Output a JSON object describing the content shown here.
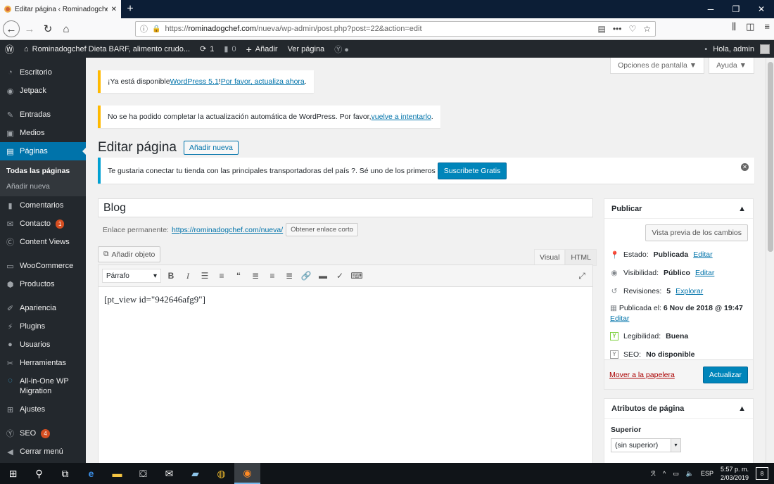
{
  "browser": {
    "tab_title": "Editar página ‹ Rominadogchef",
    "new_tab": "+",
    "url_prefix": "https://",
    "url_domain": "rominadogchef.com",
    "url_path": "/nueva/wp-admin/post.php?post=22&action=edit"
  },
  "adminbar": {
    "site": "Rominadogchef Dieta BARF, alimento crudo...",
    "updates": "1",
    "comments": "0",
    "new": "Añadir",
    "view": "Ver página",
    "howdy": "Hola, admin"
  },
  "sidebar": {
    "items": [
      {
        "label": "Escritorio",
        "icon": "dashboard-icon"
      },
      {
        "label": "Jetpack",
        "icon": "jetpack-icon"
      },
      {
        "label": "Entradas",
        "icon": "pin-icon"
      },
      {
        "label": "Medios",
        "icon": "media-icon"
      },
      {
        "label": "Páginas",
        "icon": "pages-icon"
      },
      {
        "label": "Comentarios",
        "icon": "comments-icon"
      },
      {
        "label": "Contacto",
        "icon": "mail-icon",
        "badge": "1"
      },
      {
        "label": "Content Views",
        "icon": "cv-icon"
      },
      {
        "label": "WooCommerce",
        "icon": "woo-icon"
      },
      {
        "label": "Productos",
        "icon": "box-icon"
      },
      {
        "label": "Apariencia",
        "icon": "brush-icon"
      },
      {
        "label": "Plugins",
        "icon": "plug-icon"
      },
      {
        "label": "Usuarios",
        "icon": "users-icon"
      },
      {
        "label": "Herramientas",
        "icon": "wrench-icon"
      },
      {
        "label": "All-in-One WP Migration",
        "icon": "migration-icon"
      },
      {
        "label": "Ajustes",
        "icon": "settings-icon"
      },
      {
        "label": "SEO",
        "icon": "yoast-icon",
        "badge": "4"
      },
      {
        "label": "Cerrar menú",
        "icon": "collapse-icon"
      }
    ],
    "sub": [
      "Todas las páginas",
      "Añadir nueva"
    ]
  },
  "screen": {
    "options": "Opciones de pantalla ▼",
    "help": "Ayuda ▼"
  },
  "notices": {
    "update_pre": "¡Ya está disponible ",
    "update_link1": "WordPress 5.1",
    "update_mid": "! ",
    "update_link2": "Por favor, actualiza ahora",
    "update_post": ".",
    "fail_pre": "No se ha podido completar la actualización automática de WordPress. Por favor, ",
    "fail_link": "vuelve a intentarlo",
    "fail_post": ".",
    "promo": "Te gustaria conectar tu tienda con las principales transportadoras del país ?. Sé uno de los primeros",
    "promo_btn": "Suscribete Gratis"
  },
  "page": {
    "heading": "Editar página",
    "add_new": "Añadir nueva",
    "title": "Blog",
    "perma_label": "Enlace permanente:",
    "perma_url": "https://rominadogchef.com/nueva/",
    "shortlink": "Obtener enlace corto",
    "add_media": "Añadir objeto"
  },
  "editor": {
    "tab_visual": "Visual",
    "tab_html": "HTML",
    "format": "Párrafo",
    "content": "[pt_view id=\"942646afg9\"]"
  },
  "publish": {
    "title": "Publicar",
    "preview": "Vista previa de los cambios",
    "status_label": "Estado:",
    "status": "Publicada",
    "edit": "Editar",
    "visibility_label": "Visibilidad:",
    "visibility": "Público",
    "revisions_label": "Revisiones:",
    "revisions": "5",
    "explore": "Explorar",
    "published_label": "Publicada el:",
    "published": "6 Nov de 2018 @ 19:47",
    "readability_label": "Legibilidad:",
    "readability": "Buena",
    "seo_label": "SEO:",
    "seo": "No disponible",
    "trash": "Mover a la papelera",
    "update": "Actualizar"
  },
  "attributes": {
    "title": "Atributos de página",
    "parent_label": "Superior",
    "parent_value": "(sin superior)"
  },
  "taskbar": {
    "lang": "ESP",
    "time": "5:57 p. m.",
    "date": "2/03/2019",
    "notif": "8"
  }
}
